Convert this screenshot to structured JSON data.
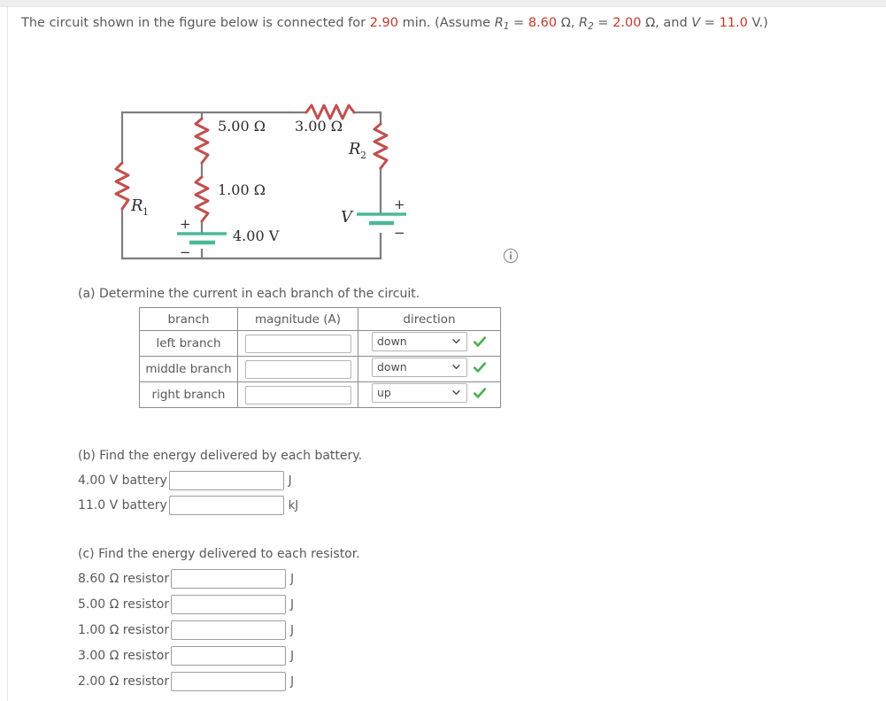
{
  "prompt": {
    "part1": "The circuit shown in the figure below is connected for ",
    "time_value": "2.90",
    "part2": " min. (Assume ",
    "r1_symbol": "R",
    "r1_sub": "1",
    "eq1": " = ",
    "r1_value": "8.60",
    "ohm1": " Ω, ",
    "r2_symbol": "R",
    "r2_sub": "2",
    "eq2": " = ",
    "r2_value": "2.00",
    "ohm2": " Ω, and ",
    "v_symbol": "V",
    "eq3": " = ",
    "v_value": "11.0",
    "tail": " V.)"
  },
  "figure": {
    "label_5ohm": "5.00 Ω",
    "label_3ohm": "3.00 Ω",
    "label_1ohm": "1.00 Ω",
    "label_4v": "4.00 V",
    "label_r1": "R",
    "label_r1_sub": "1",
    "label_r2": "R",
    "label_r2_sub": "2",
    "label_v": "V",
    "plus_left": "+",
    "minus_left": "−",
    "plus_right": "+",
    "minus_right": "−",
    "info_icon": "info-icon",
    "wire_color": "#7c7c82",
    "resistor_color": "#c0504d",
    "battery_color": "#4bb89a"
  },
  "part_a": {
    "question": "(a) Determine the current in each branch of the circuit.",
    "headers": [
      "branch",
      "magnitude (A)",
      "direction"
    ],
    "rows": [
      {
        "branch": "left branch",
        "magnitude": "",
        "direction": "down",
        "status": "correct"
      },
      {
        "branch": "middle branch",
        "magnitude": "",
        "direction": "down",
        "status": "correct"
      },
      {
        "branch": "right branch",
        "magnitude": "",
        "direction": "up",
        "status": "correct"
      }
    ],
    "direction_options": [
      "up",
      "down"
    ],
    "check_color": "#4caf50"
  },
  "part_b": {
    "question": "(b) Find the energy delivered by each battery.",
    "rows": [
      {
        "label": "4.00 V battery",
        "value": "",
        "unit": "J"
      },
      {
        "label": "11.0 V battery",
        "value": "",
        "unit": "kJ"
      }
    ]
  },
  "part_c": {
    "question": "(c) Find the energy delivered to each resistor.",
    "rows": [
      {
        "label": "8.60 Ω resistor",
        "value": "",
        "unit": "J"
      },
      {
        "label": "5.00 Ω resistor",
        "value": "",
        "unit": "J"
      },
      {
        "label": "1.00 Ω resistor",
        "value": "",
        "unit": "J"
      },
      {
        "label": "3.00 Ω resistor",
        "value": "",
        "unit": "J"
      },
      {
        "label": "2.00 Ω resistor",
        "value": "",
        "unit": "J"
      }
    ]
  }
}
